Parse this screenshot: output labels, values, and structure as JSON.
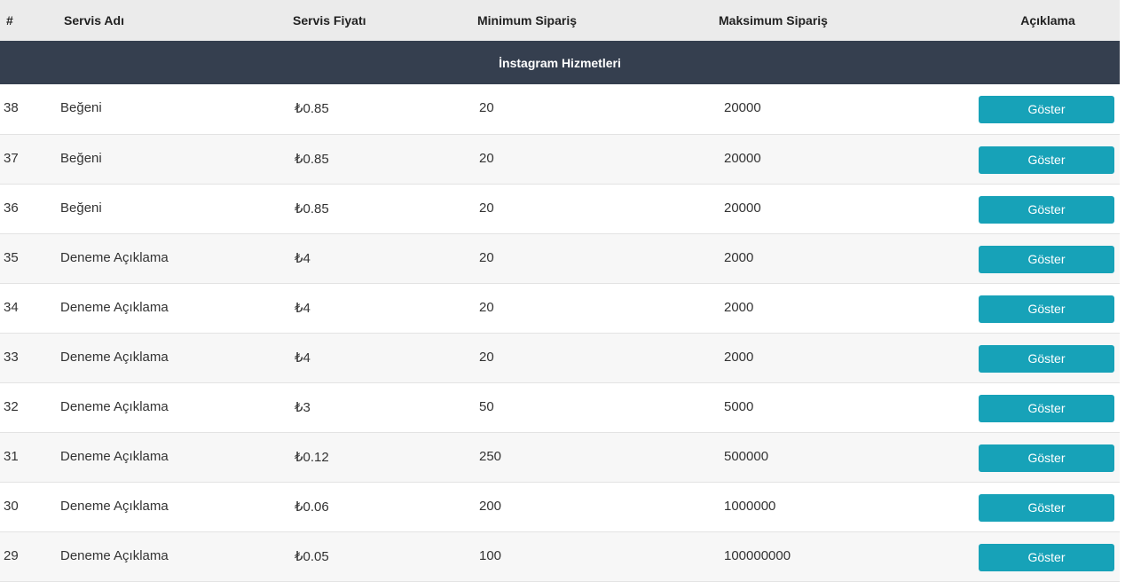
{
  "table": {
    "headers": {
      "num": "#",
      "name": "Servis Adı",
      "price": "Servis Fiyatı",
      "min": "Minimum Sipariş",
      "max": "Maksimum Sipariş",
      "desc": "Açıklama"
    },
    "category": "İnstagram Hizmetleri",
    "button_label": "Göster",
    "rows": [
      {
        "id": "38",
        "name": "Beğeni",
        "price": "₺0.85",
        "min": "20",
        "max": "20000"
      },
      {
        "id": "37",
        "name": "Beğeni",
        "price": "₺0.85",
        "min": "20",
        "max": "20000"
      },
      {
        "id": "36",
        "name": "Beğeni",
        "price": "₺0.85",
        "min": "20",
        "max": "20000"
      },
      {
        "id": "35",
        "name": "Deneme Açıklama",
        "price": "₺4",
        "min": "20",
        "max": "2000"
      },
      {
        "id": "34",
        "name": "Deneme Açıklama",
        "price": "₺4",
        "min": "20",
        "max": "2000"
      },
      {
        "id": "33",
        "name": "Deneme Açıklama",
        "price": "₺4",
        "min": "20",
        "max": "2000"
      },
      {
        "id": "32",
        "name": "Deneme Açıklama",
        "price": "₺3",
        "min": "50",
        "max": "5000"
      },
      {
        "id": "31",
        "name": "Deneme Açıklama",
        "price": "₺0.12",
        "min": "250",
        "max": "500000"
      },
      {
        "id": "30",
        "name": "Deneme Açıklama",
        "price": "₺0.06",
        "min": "200",
        "max": "1000000"
      },
      {
        "id": "29",
        "name": "Deneme Açıklama",
        "price": "₺0.05",
        "min": "100",
        "max": "100000000"
      }
    ]
  },
  "colors": {
    "header_bg": "#ebebeb",
    "category_bg": "#353f4f",
    "button_bg": "#17a2b8"
  }
}
